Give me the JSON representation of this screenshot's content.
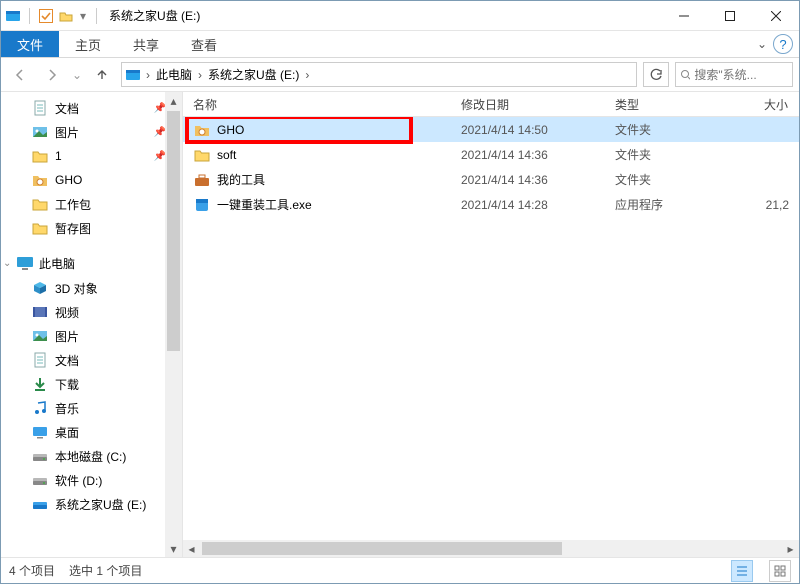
{
  "titlebar": {
    "title": "系统之家U盘 (E:)"
  },
  "ribbon": {
    "file": "文件",
    "tabs": [
      "主页",
      "共享",
      "查看"
    ]
  },
  "breadcrumb": {
    "items": [
      "此电脑",
      "系统之家U盘 (E:)"
    ]
  },
  "search": {
    "placeholder": "搜索\"系统..."
  },
  "sidebar": {
    "quick": [
      {
        "label": "文档",
        "icon": "doc",
        "pinned": true
      },
      {
        "label": "图片",
        "icon": "pic",
        "pinned": true
      },
      {
        "label": "1",
        "icon": "folder",
        "pinned": true
      },
      {
        "label": "GHO",
        "icon": "ghost",
        "pinned": false
      },
      {
        "label": "工作包",
        "icon": "folder",
        "pinned": false
      },
      {
        "label": "暂存图",
        "icon": "folder",
        "pinned": false
      }
    ],
    "thispc_label": "此电脑",
    "thispc": [
      {
        "label": "3D 对象",
        "icon": "3d"
      },
      {
        "label": "视频",
        "icon": "video"
      },
      {
        "label": "图片",
        "icon": "pic"
      },
      {
        "label": "文档",
        "icon": "doc"
      },
      {
        "label": "下载",
        "icon": "download"
      },
      {
        "label": "音乐",
        "icon": "music"
      },
      {
        "label": "桌面",
        "icon": "desktop"
      },
      {
        "label": "本地磁盘 (C:)",
        "icon": "drive"
      },
      {
        "label": "软件 (D:)",
        "icon": "drive"
      },
      {
        "label": "系统之家U盘 (E:)",
        "icon": "usb"
      }
    ]
  },
  "columns": {
    "name": "名称",
    "date": "修改日期",
    "type": "类型",
    "size": "大小"
  },
  "rows": [
    {
      "name": "GHO",
      "date": "2021/4/14 14:50",
      "type": "文件夹",
      "size": "",
      "icon": "ghost",
      "selected": true,
      "highlighted": true
    },
    {
      "name": "soft",
      "date": "2021/4/14 14:36",
      "type": "文件夹",
      "size": "",
      "icon": "folder",
      "selected": false
    },
    {
      "name": "我的工具",
      "date": "2021/4/14 14:36",
      "type": "文件夹",
      "size": "",
      "icon": "toolbox",
      "selected": false
    },
    {
      "name": "一键重装工具.exe",
      "date": "2021/4/14 14:28",
      "type": "应用程序",
      "size": "21,2",
      "icon": "exe",
      "selected": false
    }
  ],
  "status": {
    "count": "4 个项目",
    "selected": "选中 1 个项目"
  }
}
